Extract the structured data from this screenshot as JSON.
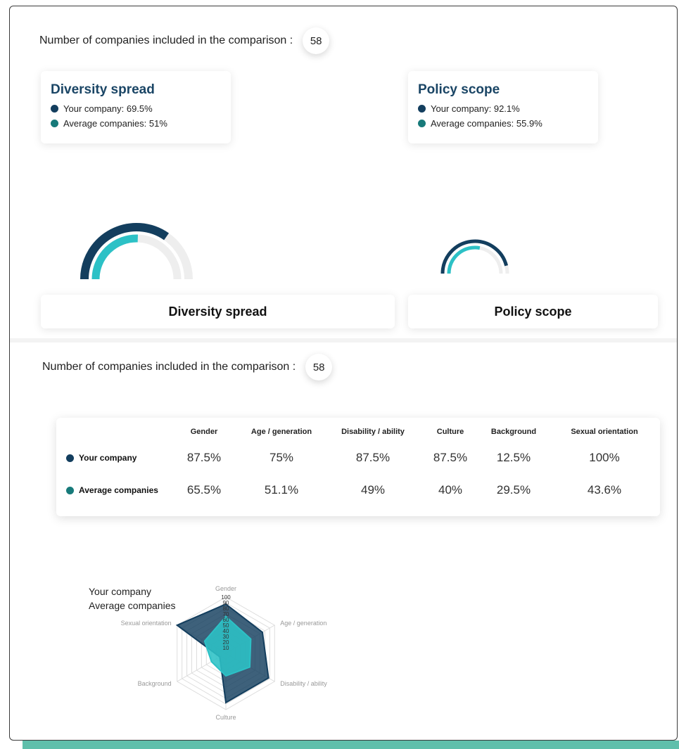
{
  "header": {
    "count_label": "Number of companies included in the comparison :",
    "count_value": "58"
  },
  "cards": [
    {
      "title": "Diversity spread",
      "your_label": "Your company: 69.5%",
      "avg_label": "Average companies: 51%",
      "your_value": 69.5,
      "avg_value": 51
    },
    {
      "title": "Policy scope",
      "your_label": "Your company: 92.1%",
      "avg_label": "Average companies: 55.9%",
      "your_value": 92.1,
      "avg_value": 55.9
    }
  ],
  "gauge_titles": [
    "Diversity spread",
    "Policy scope"
  ],
  "section2": {
    "count_label": "Number of companies included in the comparison :",
    "count_value": "58"
  },
  "table": {
    "columns": [
      "Gender",
      "Age / generation",
      "Disability / ability",
      "Culture",
      "Background",
      "Sexual orientation"
    ],
    "rows": [
      {
        "label": "Your company",
        "values": [
          "87.5%",
          "75%",
          "87.5%",
          "87.5%",
          "12.5%",
          "100%"
        ]
      },
      {
        "label": "Average companies",
        "values": [
          "65.5%",
          "51.1%",
          "49%",
          "40%",
          "29.5%",
          "43.6%"
        ]
      }
    ]
  },
  "colors": {
    "your_company": "#133e5e",
    "average": "#2cc1c6",
    "average_dot": "#177a7a",
    "track": "#eeeeee",
    "title": "#1a4565"
  },
  "chart_data": {
    "type": "radar",
    "axes": [
      "Gender",
      "Age / generation",
      "Disability / ability",
      "Culture",
      "Background",
      "Sexual orientation"
    ],
    "ticks": [
      "100",
      "90",
      "80",
      "70",
      "60",
      "50",
      "40",
      "30",
      "20",
      "10"
    ],
    "series": [
      {
        "name": "Your company",
        "values": [
          87.5,
          75,
          87.5,
          87.5,
          12.5,
          100
        ]
      },
      {
        "name": "Average companies",
        "values": [
          65.5,
          51.1,
          49,
          40,
          29.5,
          43.6
        ]
      }
    ],
    "range": [
      0,
      100
    ],
    "legend": "top-left"
  }
}
